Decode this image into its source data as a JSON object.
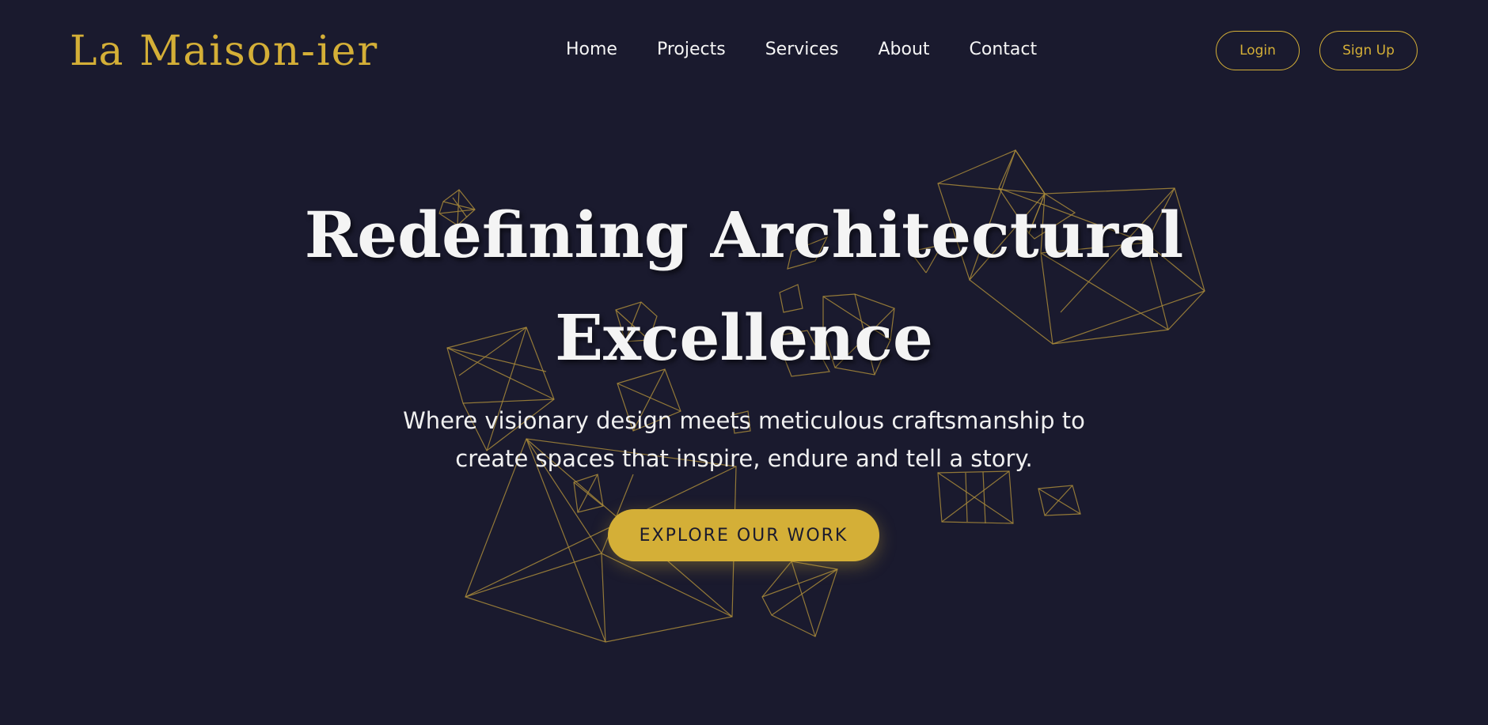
{
  "brand": {
    "logo_text": "La Maison-ier"
  },
  "nav": {
    "items": [
      {
        "label": "Home"
      },
      {
        "label": "Projects"
      },
      {
        "label": "Services"
      },
      {
        "label": "About"
      },
      {
        "label": "Contact"
      }
    ]
  },
  "auth": {
    "login_label": "Login",
    "signup_label": "Sign Up"
  },
  "hero": {
    "title_line1": "Redefining Architectural",
    "title_line2": "Excellence",
    "subtitle_line1": "Where visionary design meets meticulous craftsmanship to",
    "subtitle_line2": "create spaces that inspire, endure and tell a story.",
    "cta_label": "EXPLORE OUR WORK"
  },
  "colors": {
    "background": "#1a1a2e",
    "accent_gold": "#d4af37",
    "text_light": "#f4f4f4",
    "wireframe_stroke": "#a8893a"
  },
  "decor": {
    "icon": "wireframe-polyhedra-background"
  }
}
